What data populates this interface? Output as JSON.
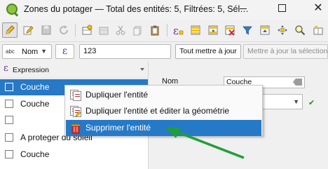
{
  "window": {
    "title": "Zones du potager — Total des entités: 5, Filtrées: 5, Sél…",
    "controls": {
      "minimize": "—",
      "maximize": "□",
      "close": "✕"
    }
  },
  "toolbar": {
    "buttons": [
      "edit-pencil-icon",
      "multi-edit-icon",
      "save-icon",
      "reload-icon",
      "add-feature-icon",
      "delete-icon",
      "cut-icon",
      "copy-icon",
      "paste-icon",
      "expression-select-icon",
      "select-all-icon",
      "invert-selection-icon",
      "deselect-icon",
      "filter-icon",
      "move-selection-top-icon",
      "pan-to-selected-icon",
      "zoom-to-selected-icon",
      "new-field-icon"
    ]
  },
  "filter_row": {
    "field_prefix": "abc",
    "field_value": "Nom",
    "value": "123",
    "update_all": "Tout mettre à jour",
    "update_selection": "Mettre à jour la sélection"
  },
  "list": {
    "header": "Expression",
    "rows": [
      {
        "label": "Couche",
        "selected": true
      },
      {
        "label": "Couche",
        "selected": false
      },
      {
        "label": "",
        "selected": false
      },
      {
        "label": "A proteger du soleil",
        "selected": false
      },
      {
        "label": "Couche",
        "selected": false
      }
    ]
  },
  "form": {
    "nom_label": "Nom",
    "nom_value": "Couche",
    "valid_icon": "✔"
  },
  "context_menu": {
    "items": [
      {
        "label": "Dupliquer l'entité",
        "icon": "duplicate-icon",
        "highlighted": false
      },
      {
        "label": "Dupliquer l'entité et éditer la géométrie",
        "icon": "duplicate-edit-icon",
        "highlighted": false
      },
      {
        "label": "Supprimer l'entité",
        "icon": "delete-feature-icon",
        "highlighted": true
      }
    ]
  },
  "colors": {
    "selection": "#2679c7",
    "annotation_arrow": "#1f9e3b",
    "expression_purple": "#6b2a8a"
  }
}
